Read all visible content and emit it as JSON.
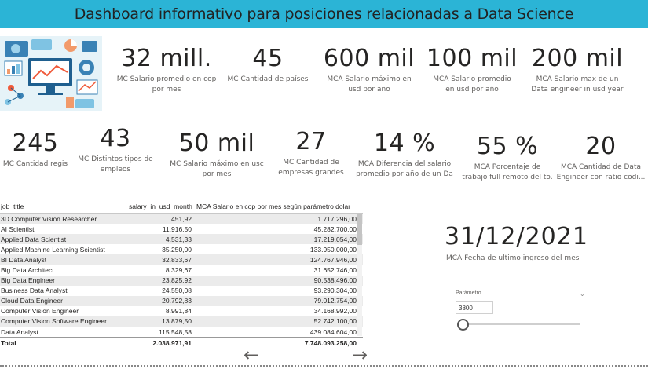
{
  "header": {
    "title": "Dashboard informativo para posiciones relacionadas a Data Science"
  },
  "cards_row1": [
    {
      "value": "32 mill.",
      "label": "MC Salario promedio en cop\npor mes"
    },
    {
      "value": "45",
      "label": "MC Cantidad de países"
    },
    {
      "value": "600 mil",
      "label": "MCA Salario máximo en\nusd por año"
    },
    {
      "value": "100 mil",
      "label": "MCA Salario promedio\nen usd por año"
    },
    {
      "value": "200 mil",
      "label": "MCA Salario max de un\nData engineer in usd year"
    }
  ],
  "cards_row2": [
    {
      "value": "245",
      "label": "MC Cantidad regis"
    },
    {
      "value": "43",
      "label": "MC Distintos tipos de\nempleos"
    },
    {
      "value": "50 mil",
      "label": "MC Salario máximo en usc\npor mes"
    },
    {
      "value": "27",
      "label": "MC Cantidad de\nempresas grandes"
    },
    {
      "value": "14 %",
      "label": "MCA Diferencia del salario\npromedio por año de un Da"
    },
    {
      "value": "55 %",
      "label": "MCA Porcentaje de\ntrabajo full remoto del to."
    },
    {
      "value": "20",
      "label": "MCA Cantidad de Data\nEngineer con ratio codi..."
    }
  ],
  "table": {
    "headers": [
      "job_title",
      "salary_in_usd_month",
      "MCA Salario en cop por mes según parámetro dolar"
    ],
    "rows": [
      [
        "3D Computer Vision Researcher",
        "451,92",
        "1.717.296,00"
      ],
      [
        "AI Scientist",
        "11.916,50",
        "45.282.700,00"
      ],
      [
        "Applied Data Scientist",
        "4.531,33",
        "17.219.054,00"
      ],
      [
        "Applied Machine Learning Scientist",
        "35.250,00",
        "133.950.000,00"
      ],
      [
        "BI Data Analyst",
        "32.833,67",
        "124.767.946,00"
      ],
      [
        "Big Data Architect",
        "8.329,67",
        "31.652.746,00"
      ],
      [
        "Big Data Engineer",
        "23.825,92",
        "90.538.496,00"
      ],
      [
        "Business Data Analyst",
        "24.550,08",
        "93.290.304,00"
      ],
      [
        "Cloud Data Engineer",
        "20.792,83",
        "79.012.754,00"
      ],
      [
        "Computer Vision Engineer",
        "8.991,84",
        "34.168.992,00"
      ],
      [
        "Computer Vision Software Engineer",
        "13.879,50",
        "52.742.100,00"
      ],
      [
        "Data Analyst",
        "115.548,58",
        "439.084.604,00"
      ]
    ],
    "total": [
      "Total",
      "2.038.971,91",
      "7.748.093.258,00"
    ]
  },
  "nav": {
    "prev": "←",
    "next": "→"
  },
  "date_card": {
    "value": "31/12/2021",
    "label": "MCA Fecha de ultimo ingreso del mes"
  },
  "parameter": {
    "title": "Parámetro",
    "chevron": "⌄",
    "value": "3800"
  },
  "illustration_icon": "data-analytics-illustration",
  "colors": {
    "title_bar": "#2bb4d6"
  }
}
